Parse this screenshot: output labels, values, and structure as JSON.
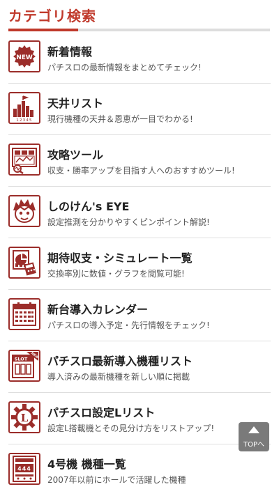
{
  "header": {
    "title": "カテゴリ検索"
  },
  "items": [
    {
      "icon": "new-badge-icon",
      "icon_text": "NEW",
      "title": "新着情報",
      "desc": "パチスロの最新情報をまとめてチェック!"
    },
    {
      "icon": "bar-graph-icon",
      "icon_text": "12345",
      "title": "天井リスト",
      "desc": "現行機種の天井＆恩恵が一目でわかる!"
    },
    {
      "icon": "strategy-tool-icon",
      "title": "攻略ツール",
      "desc": "収支・勝率アップを目指す人へのおすすめツール!"
    },
    {
      "icon": "character-face-icon",
      "title": "しのけん's EYE",
      "desc": "設定推測を分かりやすくピンポイント解説!"
    },
    {
      "icon": "chart-simulation-icon",
      "title": "期待収支・シミュレート一覧",
      "desc": "交換率別に数値・グラフを閲覧可能!"
    },
    {
      "icon": "calendar-icon",
      "title": "新台導入カレンダー",
      "desc": "パチスロの導入予定・先行情報をチェック!"
    },
    {
      "icon": "slot-new-icon",
      "icon_text": "SLOT",
      "icon_badge": "NEW",
      "title": "パチスロ最新導入機種リスト",
      "desc": "導入済みの最新機種を新しい順に掲載"
    },
    {
      "icon": "setting-l-gear-icon",
      "icon_text": "L",
      "title": "パチスロ設定Lリスト",
      "desc": "設定L搭載機とその見分け方をリストアップ!"
    },
    {
      "icon": "slot-machine-444-icon",
      "icon_text": "444",
      "title": "4号機 機種一覧",
      "desc": "2007年以前にホールで活躍した機種"
    }
  ],
  "top_button": {
    "label": "TOPへ"
  },
  "colors": {
    "accent": "#c0392b",
    "icon": "#9b2d2a",
    "rule": "#dddddd"
  }
}
